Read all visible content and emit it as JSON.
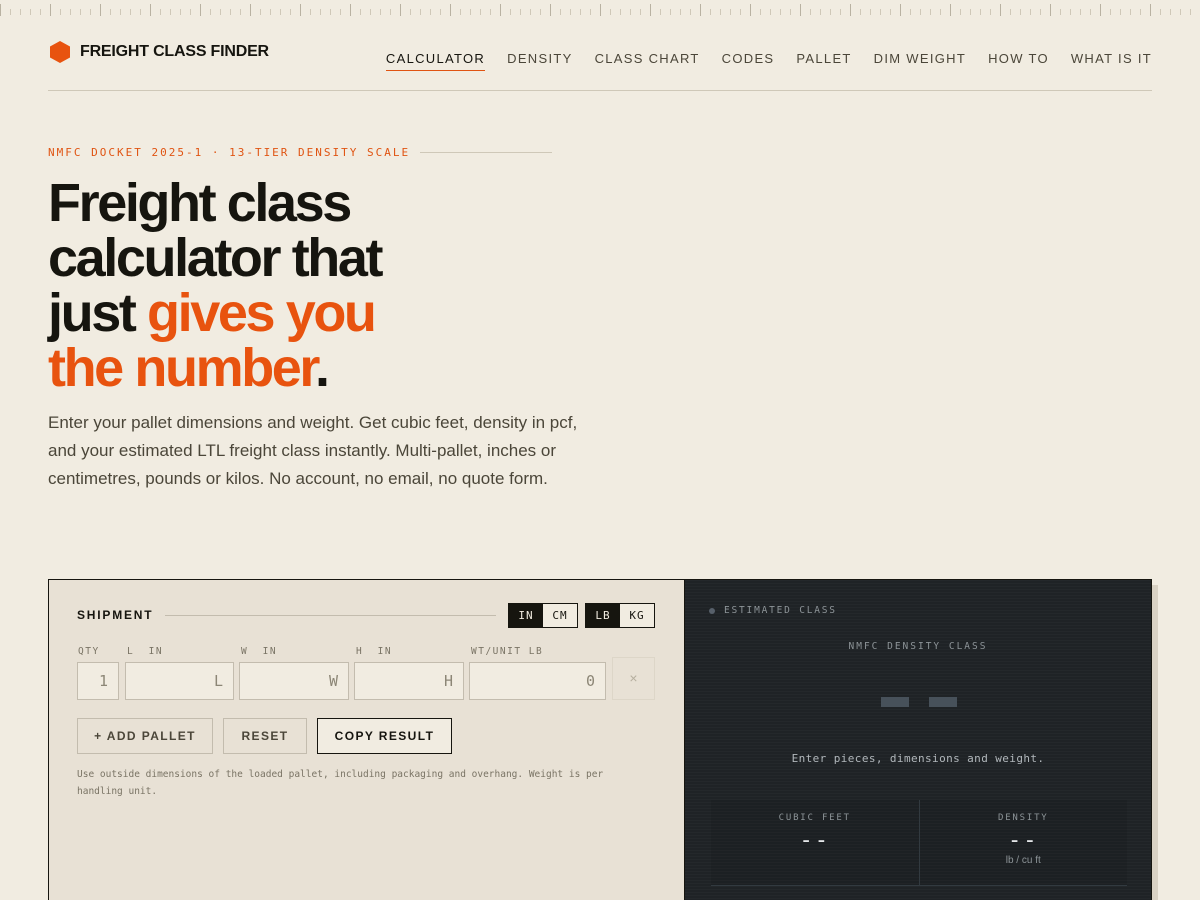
{
  "brand": {
    "name": "FREIGHT CLASS FINDER",
    "accent": "#e8530f"
  },
  "nav": [
    {
      "label": "CALCULATOR",
      "active": true
    },
    {
      "label": "DENSITY"
    },
    {
      "label": "CLASS CHART"
    },
    {
      "label": "CODES"
    },
    {
      "label": "PALLET"
    },
    {
      "label": "DIM WEIGHT"
    },
    {
      "label": "HOW TO"
    },
    {
      "label": "WHAT IS IT"
    }
  ],
  "hero": {
    "eyebrow": "NMFC DOCKET 2025-1 · 13-TIER DENSITY SCALE",
    "title_line1": "Freight class",
    "title_line2": "calculator that",
    "title_line3a": "just ",
    "title_line3b": "gives you",
    "title_line4a": "the number",
    "title_line4b": ".",
    "subtitle": "Enter your pallet dimensions and weight. Get cubic feet, density in pcf, and your estimated LTL freight class instantly. Multi-pallet, inches or centimetres, pounds or kilos. No account, no email, no quote form."
  },
  "calculator": {
    "title": "SHIPMENT",
    "length_units": [
      "IN",
      "CM"
    ],
    "length_selected": "IN",
    "weight_units": [
      "LB",
      "KG"
    ],
    "weight_selected": "LB",
    "fields": {
      "qty": {
        "label": "QTY",
        "placeholder": "1"
      },
      "length": {
        "label": "L  IN",
        "placeholder": "L"
      },
      "width": {
        "label": "W  IN",
        "placeholder": "W"
      },
      "height": {
        "label": "H  IN",
        "placeholder": "H"
      },
      "weight": {
        "label": "WT/UNIT LB",
        "placeholder": "0"
      }
    },
    "remove_label": "×",
    "buttons": {
      "add": "+ ADD PALLET",
      "reset": "RESET",
      "copy": "COPY RESULT"
    },
    "note": "Use outside dimensions of the loaded pallet, including packaging and overhang. Weight is per handling unit."
  },
  "result": {
    "tag": "ESTIMATED CLASS",
    "subtitle": "NMFC DENSITY CLASS",
    "hint": "Enter pieces, dimensions and weight.",
    "stats": [
      {
        "label": "CUBIC FEET",
        "value": "--",
        "unit": ""
      },
      {
        "label": "DENSITY",
        "value": "--",
        "unit": "lb / cu ft"
      }
    ]
  }
}
